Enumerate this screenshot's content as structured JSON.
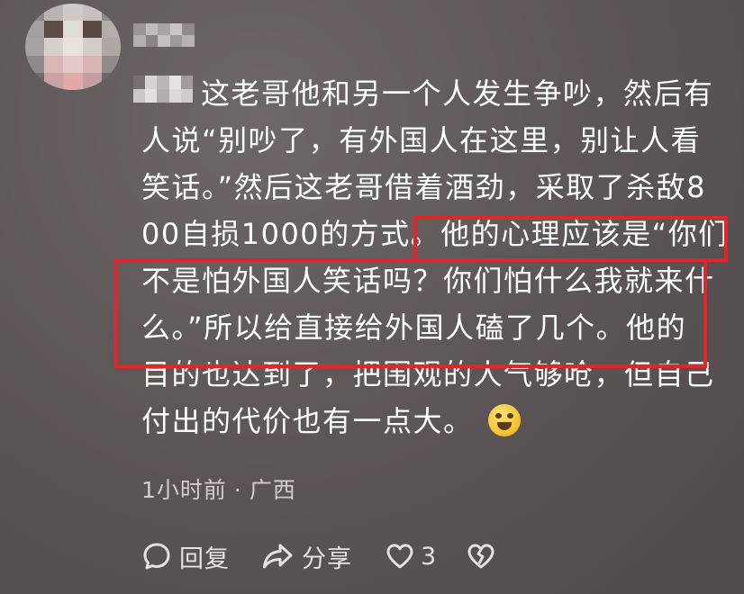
{
  "comment": {
    "lines": [
      "这老哥他和另一个人发生争吵，然后有",
      "人说“别吵了，有外国人在这里，别让人看",
      "笑话。”然后这老哥借着酒劲，采取了杀敌8",
      "00自损1000的方式。他的心理应该是“你们",
      "不是怕外国人笑话吗？你们怕什么我就来什",
      "么。”所以给直接给外国人磕了几个。他的",
      "目的也达到了，把围观的人气够呛，但自己",
      "付出的代价也有一点大。"
    ]
  },
  "meta": {
    "time": "1小时前",
    "separator": "·",
    "location": "广西"
  },
  "actions": {
    "reply_label": "回复",
    "share_label": "分享",
    "like_count": "3"
  },
  "icons": {
    "avatar": "avatar-pixelated",
    "emoji": "crying-laughing-emoji",
    "reply": "comment-bubble-icon",
    "share": "share-arrow-icon",
    "like": "heart-icon",
    "dislike": "broken-heart-icon"
  },
  "colors": {
    "highlight_box": "#e3242b",
    "background": "#5e5758"
  }
}
